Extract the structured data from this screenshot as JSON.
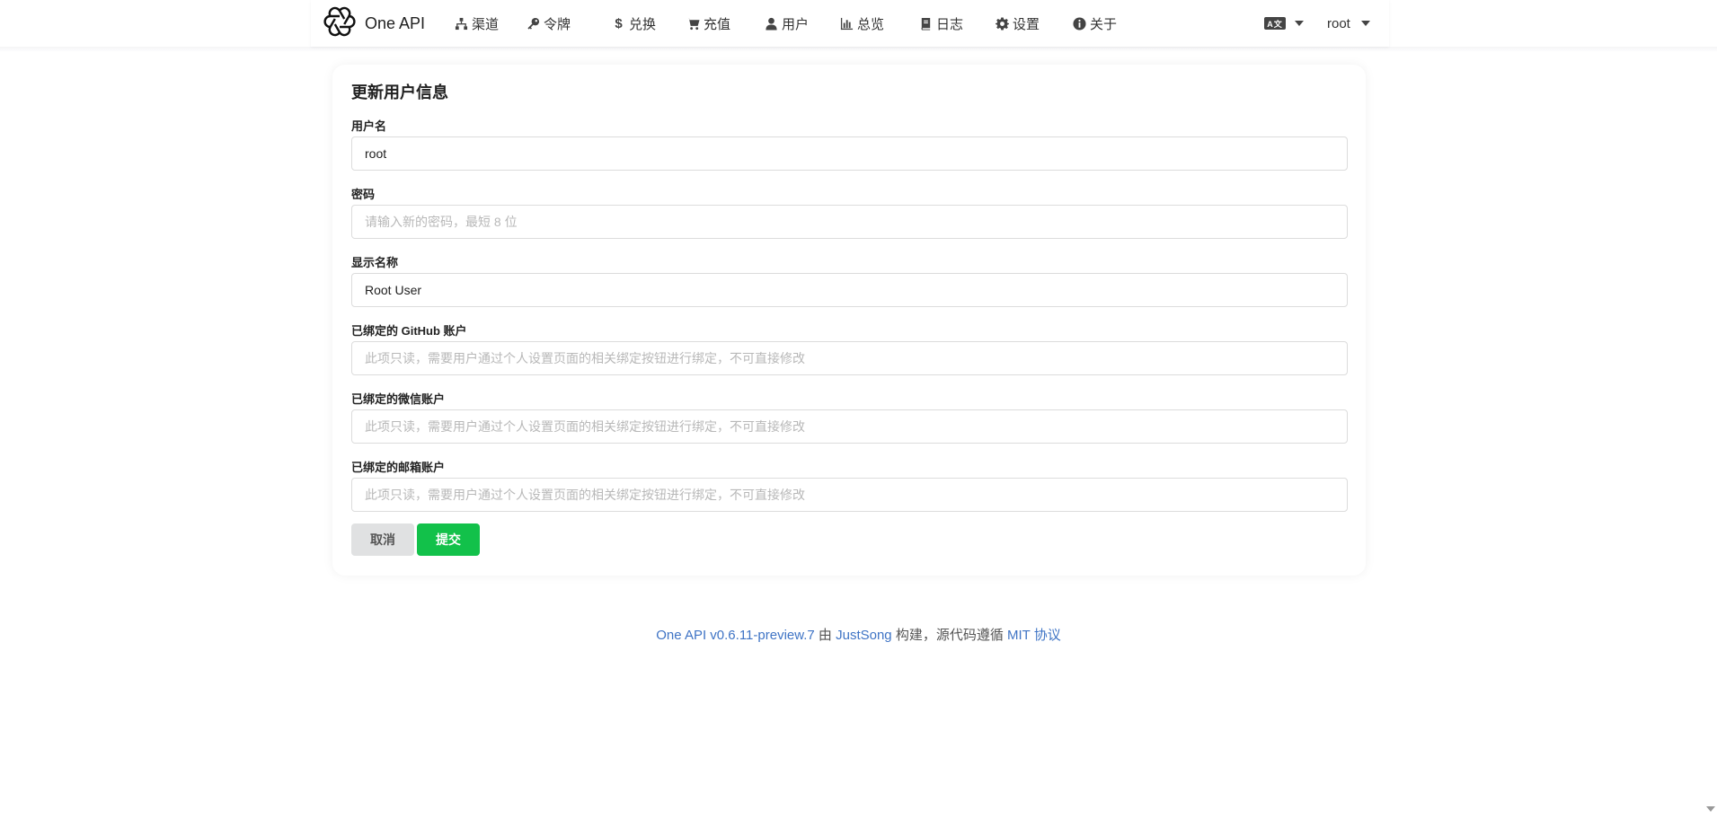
{
  "brand": {
    "name": "One API"
  },
  "nav": [
    {
      "label": "渠道",
      "icon": "sitemap-icon"
    },
    {
      "label": "令牌",
      "icon": "key-icon"
    },
    {
      "label": "兑换",
      "icon": "dollar-icon"
    },
    {
      "label": "充值",
      "icon": "cart-icon"
    },
    {
      "label": "用户",
      "icon": "user-icon"
    },
    {
      "label": "总览",
      "icon": "bar-chart-icon"
    },
    {
      "label": "日志",
      "icon": "book-icon"
    },
    {
      "label": "设置",
      "icon": "gear-icon"
    },
    {
      "label": "关于",
      "icon": "info-icon"
    }
  ],
  "language": {
    "icon_text": "A文"
  },
  "user_menu": {
    "username": "root"
  },
  "form": {
    "title": "更新用户信息",
    "username": {
      "label": "用户名",
      "value": "root"
    },
    "password": {
      "label": "密码",
      "value": "",
      "placeholder": "请输入新的密码，最短 8 位"
    },
    "display_name": {
      "label": "显示名称",
      "value": "Root User"
    },
    "github": {
      "label": "已绑定的 GitHub 账户",
      "value": "",
      "placeholder": "此项只读，需要用户通过个人设置页面的相关绑定按钮进行绑定，不可直接修改"
    },
    "wechat": {
      "label": "已绑定的微信账户",
      "value": "",
      "placeholder": "此项只读，需要用户通过个人设置页面的相关绑定按钮进行绑定，不可直接修改"
    },
    "email": {
      "label": "已绑定的邮箱账户",
      "value": "",
      "placeholder": "此项只读，需要用户通过个人设置页面的相关绑定按钮进行绑定，不可直接修改"
    },
    "cancel_label": "取消",
    "submit_label": "提交"
  },
  "footer": {
    "version_link": "One API v0.6.11-preview.7",
    "by": " 由 ",
    "author_link": "JustSong",
    "middle": " 构建，源代码遵循 ",
    "license_link": "MIT 协议"
  },
  "colors": {
    "submit": "#12c14a",
    "cancel": "#e0e1e2",
    "link": "#3f74c5"
  }
}
